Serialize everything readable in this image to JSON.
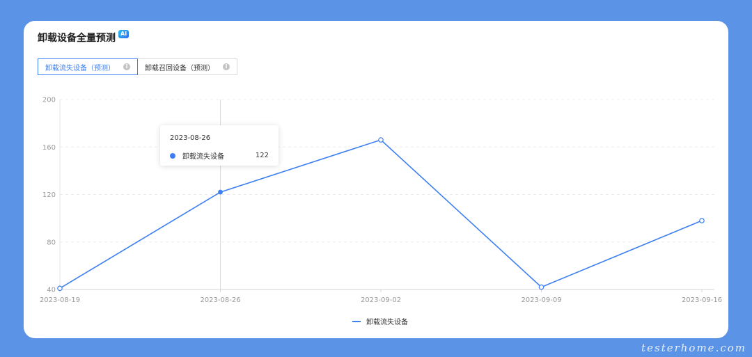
{
  "card": {
    "title": "卸载设备全量预测",
    "ai_badge": "AI"
  },
  "tabs": [
    {
      "label": "卸载流失设备（预测）",
      "active": true
    },
    {
      "label": "卸载召回设备（预测）",
      "active": false
    }
  ],
  "tooltip": {
    "date": "2023-08-26",
    "series_name": "卸载流失设备",
    "value": "122"
  },
  "legend": {
    "label": "卸载流失设备"
  },
  "watermark": "testerhome.com",
  "colors": {
    "accent": "#3d7ff0",
    "background": "#5b93e6"
  },
  "chart_data": {
    "type": "line",
    "x": [
      "2023-08-19",
      "2023-08-26",
      "2023-09-02",
      "2023-09-09",
      "2023-09-16"
    ],
    "series": [
      {
        "name": "卸载流失设备",
        "values": [
          41,
          122,
          166,
          42,
          98
        ]
      }
    ],
    "yticks": [
      40,
      80,
      120,
      160,
      200
    ],
    "ylim": [
      40,
      200
    ],
    "grid": true,
    "legend": "bottom-center",
    "title": "",
    "xlabel": "",
    "ylabel": ""
  }
}
